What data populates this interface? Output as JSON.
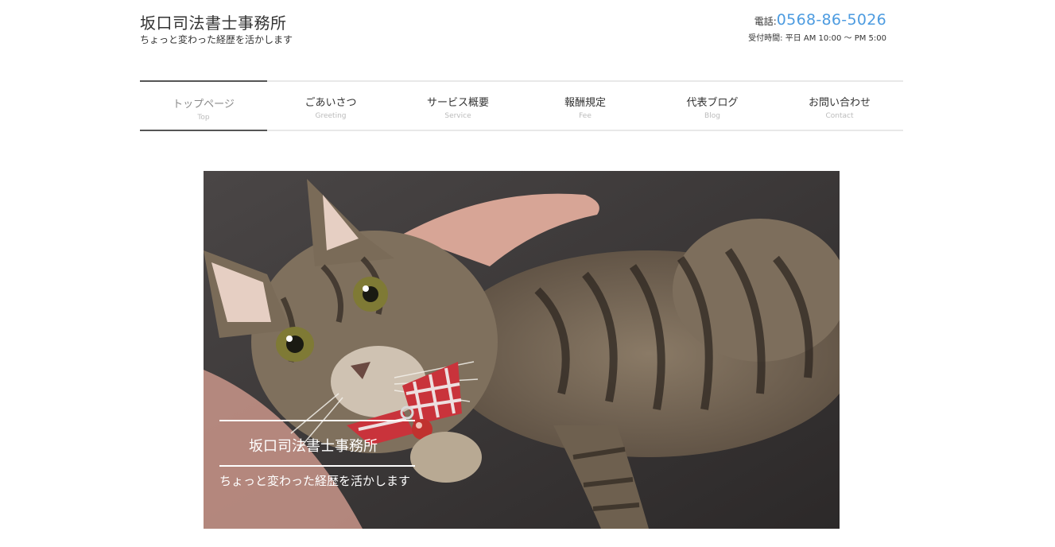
{
  "header": {
    "site_title": "坂口司法書士事務所",
    "tagline": "ちょっと変わった経歴を活かします",
    "tel_label": "電話:",
    "tel_number": "0568-86-5026",
    "hours": "受付時間: 平日 AM 10:00 〜 PM 5:00"
  },
  "nav": {
    "items": [
      {
        "label": "トップページ",
        "sub": "Top"
      },
      {
        "label": "ごあいさつ",
        "sub": "Greeting"
      },
      {
        "label": "サービス概要",
        "sub": "Service"
      },
      {
        "label": "報酬規定",
        "sub": "Fee"
      },
      {
        "label": "代表ブログ",
        "sub": "Blog"
      },
      {
        "label": "お問い合わせ",
        "sub": "Contact"
      }
    ]
  },
  "hero": {
    "title": "坂口司法書士事務所",
    "tagline": "ちょっと変わった経歴を活かします"
  },
  "colors": {
    "accent": "#4c9be0",
    "nav_border": "#e8e8e8",
    "nav_active": "#555555"
  }
}
